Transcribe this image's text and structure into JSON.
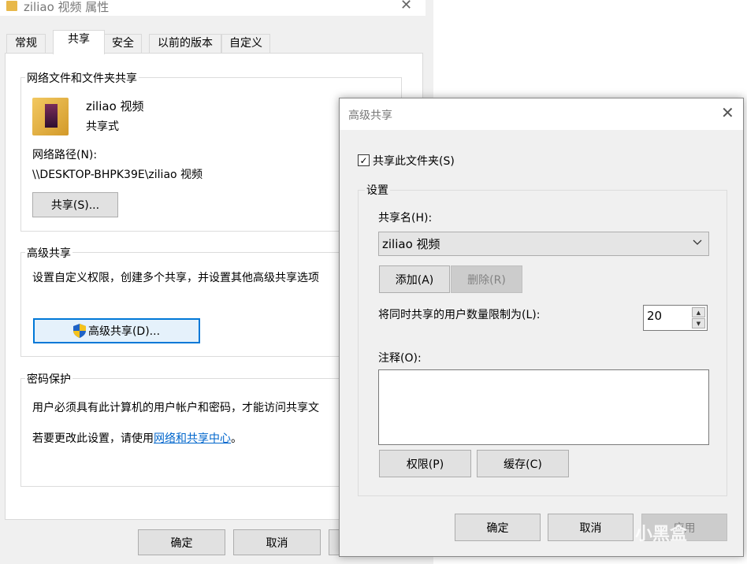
{
  "back_window": {
    "title": "ziliao 视频 属性",
    "tabs": [
      {
        "label": "常规"
      },
      {
        "label": "共享"
      },
      {
        "label": "安全"
      },
      {
        "label": "以前的版本"
      },
      {
        "label": "自定义"
      }
    ],
    "network_sharing": {
      "group_title": "网络文件和文件夹共享",
      "folder_name": "ziliao 视频",
      "share_status": "共享式",
      "network_path_label": "网络路径(N):",
      "network_path": "\\\\DESKTOP-BHPK39E\\ziliao 视频",
      "share_button": "共享(S)..."
    },
    "advanced_sharing": {
      "group_title": "高级共享",
      "description": "设置自定义权限，创建多个共享，并设置其他高级共享选项",
      "button": "高级共享(D)..."
    },
    "password_protection": {
      "group_title": "密码保护",
      "description": "用户必须具有此计算机的用户帐户和密码，才能访问共享文",
      "change_prefix": "若要更改此设置，请使用",
      "change_link": "网络和共享中心",
      "change_suffix": "。"
    },
    "footer": {
      "ok": "确定",
      "cancel": "取消"
    }
  },
  "dialog": {
    "title": "高级共享",
    "share_checkbox_label": "共享此文件夹(S)",
    "share_checked": true,
    "settings_group": "设置",
    "share_name_label": "共享名(H):",
    "share_name_value": "ziliao 视频",
    "add_button": "添加(A)",
    "remove_button": "删除(R)",
    "limit_label": "将同时共享的用户数量限制为(L):",
    "limit_value": "20",
    "comment_label": "注释(O):",
    "comment_value": "",
    "permissions_button": "权限(P)",
    "caching_button": "缓存(C)",
    "ok_button": "确定",
    "cancel_button": "取消",
    "apply_button": "应用"
  },
  "watermark": "小黑盒",
  "colors": {
    "accent": "#0078d7",
    "link": "#0066cc",
    "folder": "#e8b84a"
  }
}
